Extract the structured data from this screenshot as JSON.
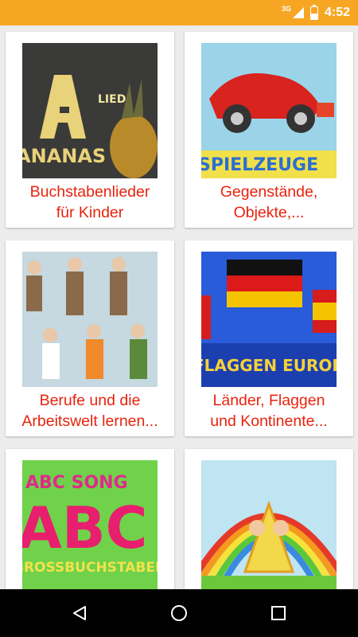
{
  "status_bar": {
    "network": "3G",
    "time": "4:52",
    "icons": [
      "signal-icon",
      "battery-charging-icon"
    ]
  },
  "cards": [
    {
      "title": "Buchstabenlieder\nfür Kinder",
      "image_icon": "ananas-letter-thumbnail"
    },
    {
      "title": "Gegenstände,\nObjekte,...",
      "image_icon": "spielzeuge-car-thumbnail"
    },
    {
      "title": "Berufe und die\nArbeitswelt lernen...",
      "image_icon": "professions-thumbnail"
    },
    {
      "title": "Länder, Flaggen\nund Kontinente...",
      "image_icon": "flags-europe-thumbnail"
    },
    {
      "title": "",
      "image_icon": "abc-song-thumbnail"
    },
    {
      "title": "",
      "image_icon": "rainbow-kids-thumbnail"
    }
  ],
  "thumb_text": {
    "ananas_lied": "LIED",
    "ananas_word": "ANANAS",
    "spielzeuge": "SPIELZEUGE",
    "flaggen": "FLAGGEN EUROPA",
    "abc_song": "ABC SONG",
    "abc_letters": "ABC",
    "gross": "GROSSBUCHSTABEN"
  },
  "nav_bar": {
    "icons": [
      "back-icon",
      "home-icon",
      "recents-icon"
    ]
  },
  "colors": {
    "status_bar": "#f6a623",
    "title_text": "#e8230e",
    "background": "#ececec"
  }
}
